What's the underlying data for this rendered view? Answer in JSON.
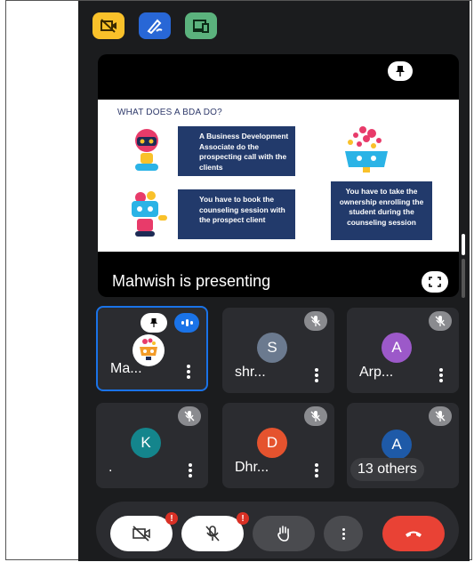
{
  "toolbar": {
    "icons": [
      "no-video-camera-icon",
      "pen-annotate-icon",
      "devices-icon"
    ],
    "colors": {
      "yellow": "#f9c12a",
      "blue": "#2867d6",
      "green": "#5bb27d"
    }
  },
  "presentation": {
    "slide": {
      "title": "WHAT DOES A BDA DO?",
      "box1": "A Business Development Associate do the prospecting call with the clients",
      "box2": "You have to book the counseling session with the prospect client",
      "box3": "You have to take the ownership  enrolling the student during the counseling session"
    },
    "presenting_label": "Mahwish  is presenting"
  },
  "participants": [
    {
      "name": "Ma...",
      "initial": "",
      "avatar_color": "",
      "muted": false,
      "speaking": true,
      "pinned": true
    },
    {
      "name": "shr...",
      "initial": "S",
      "avatar_color": "#6b7a8f",
      "muted": true
    },
    {
      "name": "Arp...",
      "initial": "A",
      "avatar_color": "#9c59c9",
      "muted": true
    },
    {
      "name": ".",
      "initial": "K",
      "avatar_color": "#14858c",
      "muted": true
    },
    {
      "name": "Dhr...",
      "initial": "D",
      "avatar_color": "#e5532e",
      "muted": true
    },
    {
      "name": "",
      "initial": "A",
      "avatar_color": "#1e5aa8",
      "muted": true,
      "others_label": "13 others"
    }
  ],
  "controls": {
    "camera_alert": "!",
    "mic_alert": "!",
    "end_call_color": "#e94235"
  }
}
